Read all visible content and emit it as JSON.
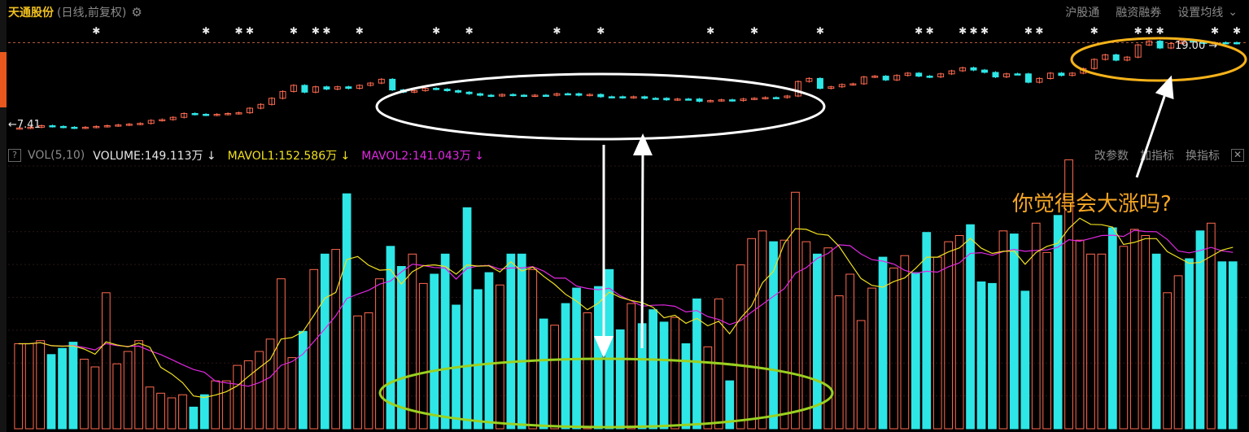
{
  "header": {
    "stock_name": "天通股份",
    "subtitle": "(日线,前复权)",
    "menu": [
      "沪股通",
      "融资融券",
      "设置均线"
    ]
  },
  "price_labels": {
    "low": "←7.41",
    "high": "19.00 →"
  },
  "volume_header": {
    "help": "?",
    "label": "VOL(5,10)",
    "volume": "VOLUME:149.113万 ↓",
    "mavol1": "MAVOL1:152.586万 ↓",
    "mavol2": "MAVOL2:141.043万 ↓",
    "menu": [
      "改参数",
      "加指标",
      "换指标"
    ],
    "close": "✕"
  },
  "annotation": {
    "question": "你觉得会大涨吗?"
  },
  "colors": {
    "up": "#ff6a50",
    "down": "#2ee6e6",
    "mavol1": "#f0e020",
    "mavol2": "#e028e0",
    "white_ellipse": "#ffffff",
    "green_ellipse": "#9ad020",
    "gold_ellipse": "#f5b21a",
    "title": "#f0c020"
  },
  "chart_data": [
    {
      "type": "candlestick",
      "title": "天通股份",
      "subtitle": "(日线,前复权)",
      "y_min_marked": 7.41,
      "y_max_marked": 19.0,
      "closes": [
        7.5,
        7.6,
        7.8,
        7.7,
        7.6,
        7.5,
        7.6,
        7.7,
        7.8,
        7.9,
        8.0,
        8.1,
        8.5,
        8.6,
        8.9,
        9.4,
        9.3,
        9.2,
        9.3,
        9.4,
        9.5,
        10.1,
        10.6,
        11.4,
        12.3,
        13.1,
        12.2,
        12.9,
        12.6,
        12.9,
        12.7,
        13.1,
        13.4,
        13.9,
        12.5,
        12.2,
        12.4,
        12.7,
        12.6,
        12.4,
        12.2,
        12.0,
        11.8,
        11.7,
        11.9,
        11.8,
        11.7,
        11.8,
        11.8,
        12.0,
        12.0,
        11.8,
        11.9,
        11.6,
        11.6,
        11.5,
        11.6,
        11.4,
        11.4,
        11.2,
        11.3,
        11.3,
        11.0,
        11.1,
        11.2,
        11.1,
        11.3,
        11.4,
        11.5,
        11.5,
        11.7,
        13.6,
        14.0,
        12.7,
        12.9,
        13.2,
        13.3,
        14.2,
        14.3,
        13.8,
        14.4,
        14.7,
        14.3,
        14.2,
        14.6,
        15.0,
        15.4,
        15.1,
        14.8,
        14.2,
        14.6,
        14.6,
        13.5,
        14.0,
        14.7,
        14.4,
        14.7,
        15.3,
        16.5,
        17.1,
        16.4,
        16.8,
        18.4,
        18.9,
        18.0,
        18.6,
        19.0,
        18.8,
        18.6,
        18.7,
        18.7,
        18.6
      ],
      "up_flags": [
        1,
        1,
        1,
        0,
        0,
        0,
        1,
        1,
        1,
        1,
        1,
        1,
        1,
        1,
        1,
        1,
        0,
        0,
        1,
        1,
        1,
        1,
        1,
        1,
        1,
        1,
        0,
        1,
        0,
        1,
        0,
        1,
        1,
        1,
        0,
        0,
        1,
        1,
        0,
        0,
        0,
        0,
        0,
        0,
        1,
        0,
        0,
        1,
        0,
        1,
        0,
        0,
        1,
        0,
        0,
        0,
        1,
        0,
        0,
        0,
        1,
        0,
        0,
        1,
        1,
        0,
        1,
        1,
        1,
        0,
        1,
        1,
        1,
        0,
        1,
        1,
        1,
        1,
        1,
        0,
        1,
        1,
        0,
        0,
        1,
        1,
        1,
        0,
        0,
        0,
        1,
        0,
        0,
        1,
        1,
        0,
        1,
        1,
        1,
        1,
        0,
        1,
        1,
        1,
        0,
        1,
        1,
        0,
        0,
        1,
        0,
        0
      ]
    },
    {
      "type": "bar",
      "title": "VOL(5,10)",
      "series": [
        {
          "name": "VOLUME",
          "unit": "万",
          "values": [
            55,
            55,
            57,
            48,
            52,
            56,
            45,
            40,
            88,
            42,
            50,
            57,
            27,
            23,
            20,
            22,
            14,
            22,
            31,
            31,
            41,
            44,
            50,
            58,
            97,
            46,
            63,
            103,
            113,
            116,
            152,
            73,
            75,
            97,
            118,
            105,
            113,
            94,
            100,
            113,
            80,
            143,
            90,
            101,
            93,
            113,
            113,
            103,
            71,
            67,
            81,
            91,
            75,
            92,
            103,
            64,
            81,
            68,
            77,
            69,
            72,
            55,
            84,
            53,
            84,
            31,
            106,
            123,
            128,
            121,
            122,
            153,
            121,
            113,
            117,
            86,
            100,
            70,
            91,
            111,
            104,
            112,
            101,
            127,
            111,
            121,
            125,
            132,
            95,
            94,
            128,
            126,
            89,
            133,
            114,
            138,
            174,
            122,
            113,
            113,
            130,
            118,
            129,
            125,
            113,
            88,
            99,
            110,
            128,
            133,
            108,
            108
          ]
        },
        {
          "name": "MAVOL1",
          "unit": "万",
          "values": []
        },
        {
          "name": "MAVOL2",
          "unit": "万",
          "values": []
        }
      ],
      "last_values": {
        "VOLUME": 149.113,
        "MAVOL1": 152.586,
        "MAVOL2": 141.043
      }
    }
  ]
}
